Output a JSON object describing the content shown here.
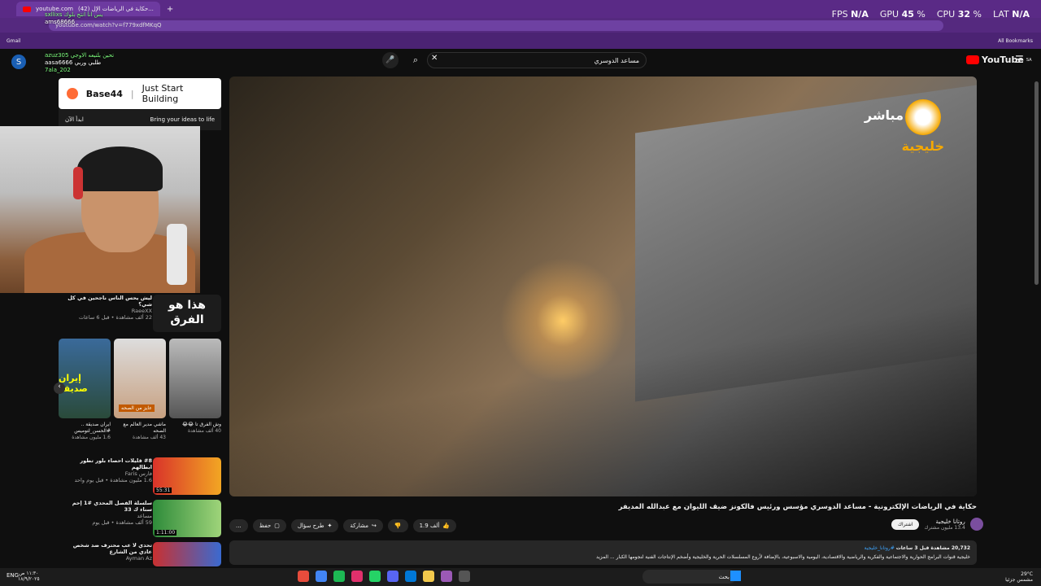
{
  "browser": {
    "tab_title": "youtube.com",
    "tab_full": "(42) حكاية في الرياضات الإل...",
    "new_tab": "+",
    "address": "youtube.com/watch?v=f779xdfMKqQ",
    "bookmarks_left": "Gmail",
    "bookmarks_right": "All Bookmarks"
  },
  "overlay_stats": {
    "fps_label": "FPS",
    "fps_value": "N/A",
    "gpu_label": "GPU",
    "gpu_value": "45",
    "cpu_label": "CPU",
    "cpu_value": "32",
    "lat_label": "LAT",
    "lat_value": "N/A"
  },
  "chat_overlay": {
    "lines": [
      "sxllixs يس انا انتج بلوك",
      "ams68666",
      "azuz305 تحين بلتيعه الاوجي",
      "aasa6666 طلبي وربي",
      "7ala_202"
    ]
  },
  "youtube": {
    "avatar_letter": "S",
    "search_value": "مساعد الدوسري",
    "logo_text": "YouTube",
    "logo_region": "SA"
  },
  "video": {
    "channel_overlay_live": "مباشر",
    "channel_overlay_name": "خليجية",
    "title": "حكاية في الرياضات الإلكترونية - مساعد الدوسري مؤسس ورئيس فالكونز ضيف الليوان مع عبدالله المديفر",
    "likes": "1.9 ألف",
    "share": "مشاركة",
    "ask": "طرح سؤال",
    "save": "حفظ",
    "more": "...",
    "channel_name": "روتانا خليجية",
    "channel_subs": "13.4 مليون مشترك",
    "subscribe": "اشتراك",
    "views_line": "20,732 مشاهدة قبل 3 ساعات",
    "hashtag": "#روتانا_خليجية",
    "desc_line": "خليجية قنوات البرامج الحوارية والاجتماعية والفكرية والرياضية والاقتصادية، اليومية والاسبوعية، بالإضافة لأروع المسلسلات الحرية والخليجية وأضخم الإنتاجات الفنية لنجومها الكبار ... المزيد"
  },
  "ad": {
    "brand": "Base44",
    "tagline": "Just Start Building",
    "sub": "Bring your ideas to life",
    "cta": "ابدأ الآن"
  },
  "recommended": [
    {
      "title": "ليش يحس الناس ناجحين في كل شي؟",
      "channel": "RaeeXX",
      "meta": "22 ألف مشاهدة • قبل 6 ساعات",
      "thumb_text": "هذا هو الفرق"
    },
    {
      "title": "#8 قليلات احصاء بلور تطور ابطالهم",
      "channel": "فارس Faris",
      "meta": "1.6 مليون مشاهدة • قبل يوم واحد",
      "duration": "55:31"
    },
    {
      "title": "سلسلة الفصل المحدي #1 إحم سناء ك 33",
      "channel": "مساعد",
      "meta": "59 ألف مشاهدة • قبل يوم",
      "duration": "1:11:00"
    },
    {
      "title": "تحدي لا عب محترف ضد شخص عادي من الشارع",
      "channel": "Ayman Az",
      "meta": ""
    }
  ],
  "shorts": [
    {
      "title": "وش الفرق تا 😂😂",
      "meta": "40 ألف مشاهدة",
      "thumb_text": ""
    },
    {
      "title": "ماشي مدير العالم مع الصحه",
      "meta": "43 ألف مشاهدة",
      "thumb_text": "عايز من الصحه"
    },
    {
      "title": "ايران صديقة .. #الحسن_لتوميس",
      "meta": "1.6 مليون مشاهدة",
      "thumb_text": "إيران صديقة"
    }
  ],
  "taskbar": {
    "search": "بحث",
    "lang": "ENG",
    "temp": "29°C",
    "weather": "مشمس جزئيا",
    "time": "١١:٣٠ ص",
    "date": "١٨/٩/٢٠٢٥"
  },
  "colors": {
    "brand_red": "#ff0000",
    "browser_purple": "#5a2a86"
  }
}
